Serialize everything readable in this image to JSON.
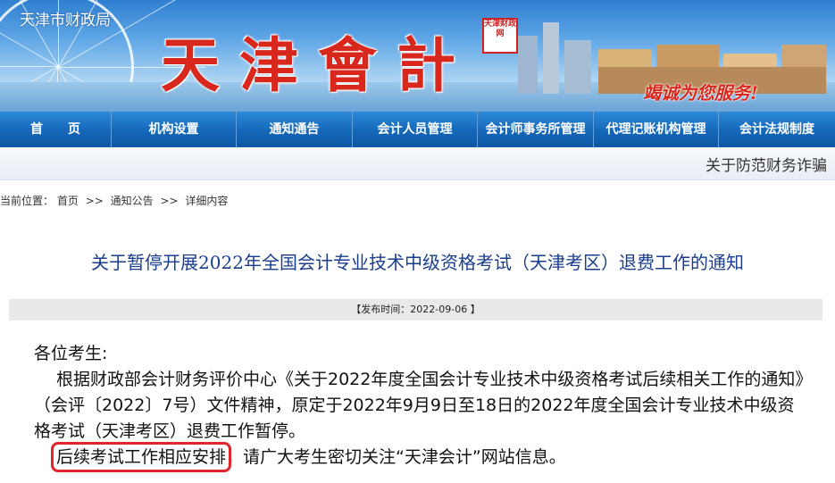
{
  "header": {
    "site_name": "天津市财政局",
    "logo_text": "天津會計",
    "seal_text": "天津财政网",
    "slogan": "竭诚为您服务!"
  },
  "nav": {
    "items": [
      "首　　页",
      "机构设置",
      "通知通告",
      "会计人员管理",
      "会计师事务所管理",
      "代理记账机构管理",
      "会计法规制度"
    ]
  },
  "ticker": {
    "text": "关于防范财务诈骗"
  },
  "breadcrumb": {
    "prefix": "当前位置：",
    "items": [
      "首页",
      "通知公告",
      "详细内容"
    ],
    "separator": ">>"
  },
  "article": {
    "title": "关于暂停开展2022年全国会计专业技术中级资格考试（天津考区）退费工作的通知",
    "publish_time": "【发布时间：2022-09-06 】",
    "greeting": "各位考生:",
    "paragraph1": "根据财政部会计财务评价中心《关于2022年度全国会计专业技术中级资格考试后续相关工作的通知》（会评〔2022〕7号）文件精神，原定于2022年9月9日至18日的2022年度全国会计专业技术中级资格考试（天津考区）退费工作暂停。",
    "paragraph2_highlight": "后续考试工作相应安排",
    "paragraph2_rest": "，请广大考生密切关注“天津会计”网站信息。"
  },
  "colors": {
    "nav_bg": "#1567b8",
    "title_blue": "#1a3e8c",
    "highlight_red": "#e0262b",
    "logo_red": "#d8281e"
  }
}
